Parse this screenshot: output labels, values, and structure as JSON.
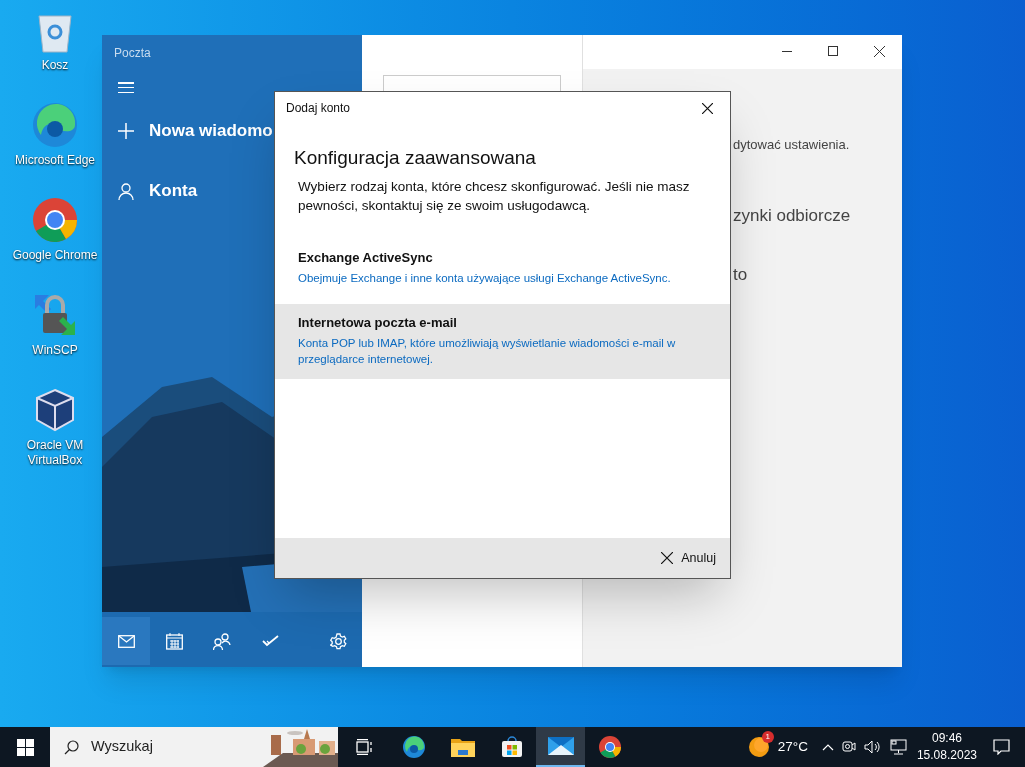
{
  "desktop_icons": [
    {
      "label": "Kosz",
      "kind": "bin"
    },
    {
      "label": "Microsoft Edge",
      "kind": "edge"
    },
    {
      "label": "Google Chrome",
      "kind": "chrome"
    },
    {
      "label": "WinSCP",
      "kind": "winscp"
    },
    {
      "label": "Oracle VM VirtualBox",
      "kind": "vbox"
    }
  ],
  "mail_window": {
    "title": "Poczta",
    "nav": [
      {
        "label": "Nowa wiadomo",
        "kind": "new"
      },
      {
        "label": "Konta",
        "kind": "accounts"
      }
    ],
    "bottom_tabs": [
      {
        "kind": "mail",
        "selected": true
      },
      {
        "kind": "calendar",
        "selected": false
      },
      {
        "kind": "people",
        "selected": false
      },
      {
        "kind": "todo",
        "selected": false
      },
      {
        "kind": "settings",
        "selected": false
      }
    ],
    "settings_pane": {
      "lines": [
        "dytować ustawienia.",
        "zynki odbiorcze",
        "to"
      ]
    }
  },
  "dialog": {
    "title": "Dodaj konto",
    "heading": "Konfiguracja zaawansowana",
    "description": "Wybierz rodzaj konta, które chcesz skonfigurować. Jeśli nie masz pewności, skontaktuj się ze swoim usługodawcą.",
    "options": [
      {
        "title": "Exchange ActiveSync",
        "description": "Obejmuje Exchange i inne konta używające usługi Exchange ActiveSync.",
        "selected": false
      },
      {
        "title": "Internetowa poczta e-mail",
        "description": "Konta POP lub IMAP, które umożliwiają wyświetlanie wiadomości e-mail w przeglądarce internetowej.",
        "selected": true
      }
    ],
    "cancel": "Anuluj"
  },
  "taskbar": {
    "search_placeholder": "Wyszukaj",
    "apps": [
      {
        "kind": "taskview",
        "selected": false
      },
      {
        "kind": "edge",
        "selected": false
      },
      {
        "kind": "explorer",
        "selected": false
      },
      {
        "kind": "store",
        "selected": false
      },
      {
        "kind": "mail",
        "selected": true
      },
      {
        "kind": "chrome",
        "selected": false
      }
    ],
    "weather": {
      "badge": "1",
      "temperature": "27°C"
    },
    "time": "09:46",
    "date": "15.08.2023"
  }
}
